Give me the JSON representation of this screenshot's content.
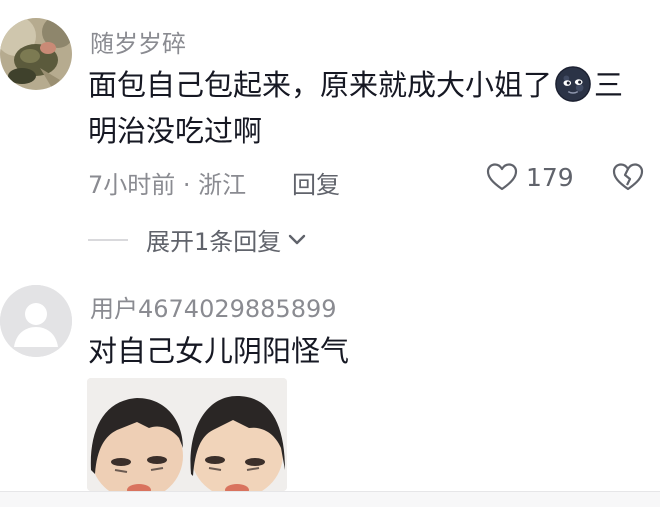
{
  "comments": [
    {
      "username": "随岁岁碎",
      "text_line1": "面包自己包起来，原来就成大小姐了",
      "text_after_emoji": "三",
      "text_line2": "明治没吃过啊",
      "emoji_icon": "dark-moon-face-emoji",
      "meta": "7小时前 · 浙江",
      "reply_label": "回复",
      "like_count": "179",
      "expand_label": "展开1条回复"
    },
    {
      "username": "用户4674029885899",
      "text": "对自己女儿阴阳怪气",
      "attachment": "meme-sticker-image"
    }
  ],
  "colors": {
    "text": "#161823",
    "secondary": "#8a8b91",
    "icon": "#60636b"
  }
}
